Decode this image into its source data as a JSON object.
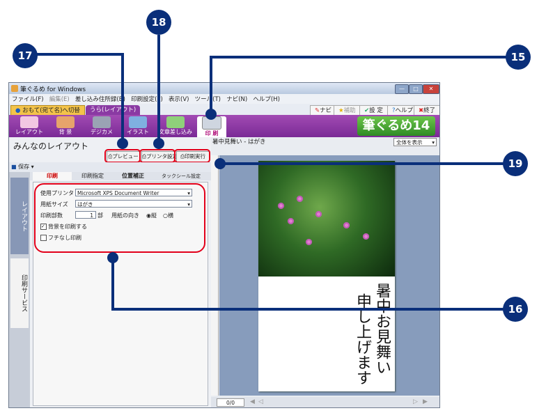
{
  "callouts": [
    "15",
    "16",
    "17",
    "18",
    "19"
  ],
  "window": {
    "title": "筆ぐるめ for Windows",
    "menu": [
      "ファイル(F)",
      "編集(E)",
      "差し込み住所録(B)",
      "印刷設定(P)",
      "表示(V)",
      "ツール(T)",
      "ナビ(N)",
      "ヘルプ(H)"
    ],
    "tabs": {
      "left": "おもて(宛て名)へ切替",
      "right": "うら(レイアウト)"
    },
    "top_buttons": [
      "ナビ",
      "補助",
      "設 定",
      "ヘルプ",
      "終了"
    ],
    "ribbon": [
      "レイアウト",
      "背 景",
      "デジカメ",
      "イラスト",
      "文章差し込み",
      "印 刷"
    ],
    "logo": "筆ぐるめ14"
  },
  "left": {
    "title": "みんなのレイアウト",
    "save": "保存",
    "buttons": {
      "preview": "プレビュー",
      "printer_settings": "プリンタ設定",
      "print_run": "印刷実行"
    },
    "vtabs": [
      "レイアウト",
      "印刷サービス"
    ],
    "inner_tabs": [
      "印刷",
      "印刷指定",
      "位置補正",
      "タックシール設定"
    ],
    "form": {
      "printer_label": "使用プリンタ",
      "printer_value": "Microsoft XPS Document Writer",
      "paper_label": "用紙サイズ",
      "paper_value": "はがき",
      "copies_label": "印刷部数",
      "copies_value": "1",
      "copies_unit": "部",
      "orientation_label": "用紙の向き",
      "orientation_portrait": "縦",
      "orientation_landscape": "横",
      "bg_print": "背景を印刷する",
      "borderless": "フチなし印刷"
    }
  },
  "right": {
    "title": "暑中見舞い - はがき",
    "zoom": "全体を表示",
    "page": "0/0",
    "calligraphy": [
      "暑中お見舞い",
      "申し上げます"
    ]
  },
  "colors": {
    "callout": "#0a2f7a",
    "highlight": "#e2001a",
    "ribbon": "#8a3aa3"
  }
}
